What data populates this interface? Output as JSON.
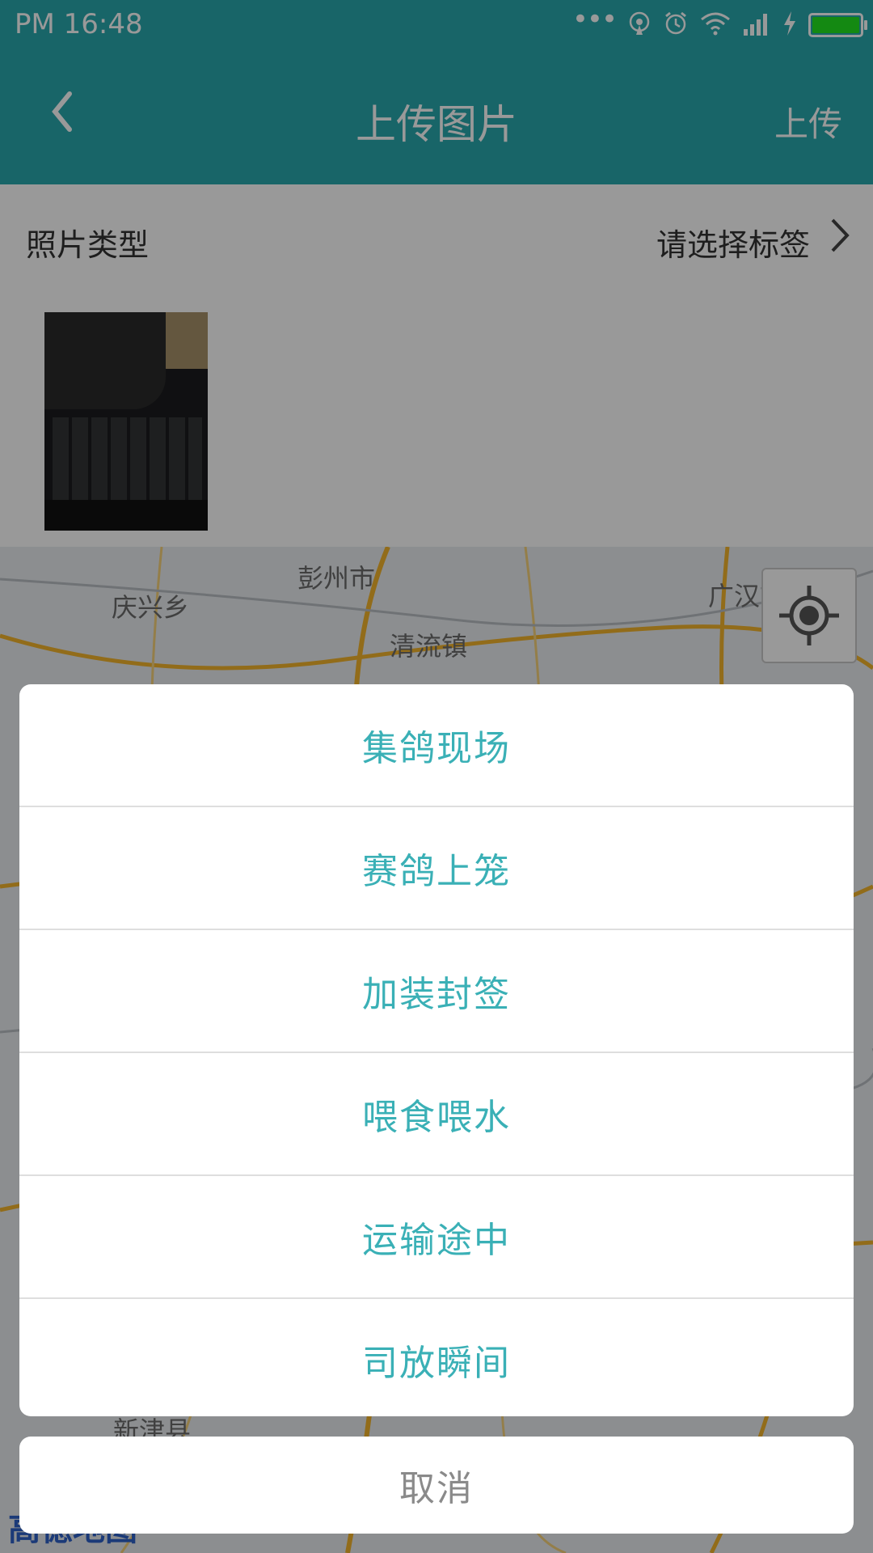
{
  "status_bar": {
    "time": "PM  16:48",
    "battery_color": "#22e51e"
  },
  "app_bar": {
    "back_icon": "back-chevron-icon",
    "title": "上传图片",
    "action_label": "上传",
    "color": "#28a8ad"
  },
  "photo_type": {
    "label": "照片类型",
    "value": "请选择标签"
  },
  "map": {
    "labels": [
      "彭州市",
      "庆兴乡",
      "清流镇",
      "广汉市",
      "新津县"
    ],
    "logo": "高德地图",
    "locate_icon": "crosshair-icon"
  },
  "action_sheet": {
    "items": [
      "集鸽现场",
      "赛鸽上笼",
      "加装封签",
      "喂食喂水",
      "运输途中",
      "司放瞬间"
    ],
    "cancel_label": "取消",
    "accent_color": "#3ab0b6"
  }
}
